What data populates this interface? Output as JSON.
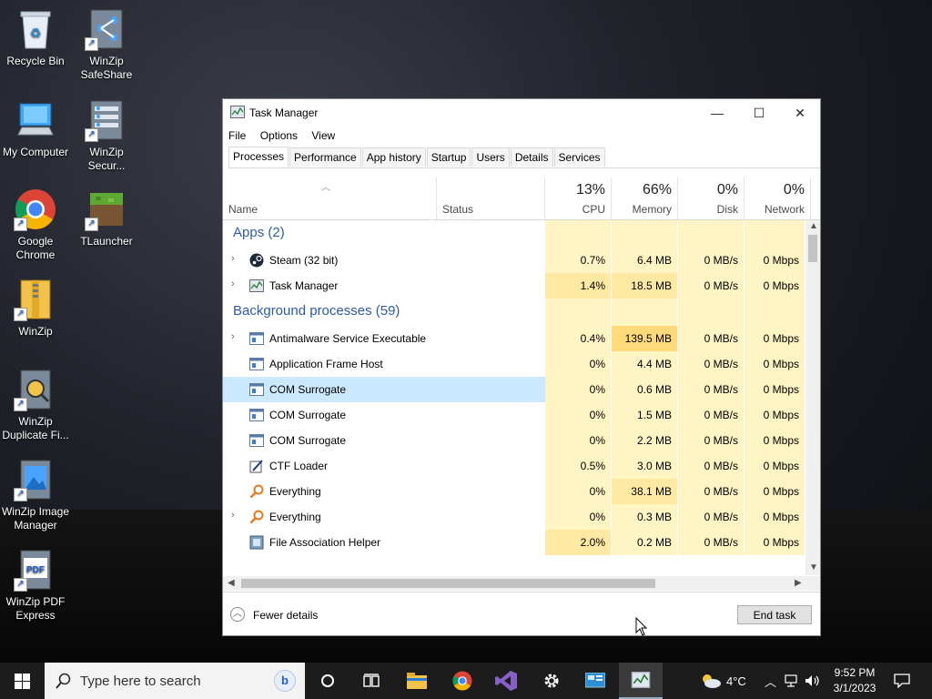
{
  "desktop": {
    "icons": [
      {
        "label": "Recycle Bin",
        "icon": "recycle-bin-icon"
      },
      {
        "label": "WinZip SafeShare",
        "icon": "winzip-safeshare-icon"
      },
      {
        "label": "My Computer",
        "icon": "computer-icon"
      },
      {
        "label": "WinZip Secur...",
        "icon": "winzip-secure-icon"
      },
      {
        "label": "Google Chrome",
        "icon": "chrome-icon"
      },
      {
        "label": "TLauncher",
        "icon": "tlauncher-icon"
      },
      {
        "label": "WinZip",
        "icon": "winzip-icon"
      },
      {
        "label": "WinZip Duplicate Fi...",
        "icon": "winzip-duplicate-icon"
      },
      {
        "label": "WinZip Image Manager",
        "icon": "winzip-image-icon"
      },
      {
        "label": "WinZip PDF Express",
        "icon": "winzip-pdf-icon"
      }
    ]
  },
  "window": {
    "title": "Task Manager",
    "controls": {
      "minimize": "—",
      "maximize": "☐",
      "close": "✕"
    },
    "menu": [
      "File",
      "Options",
      "View"
    ],
    "tabs": [
      "Processes",
      "Performance",
      "App history",
      "Startup",
      "Users",
      "Details",
      "Services"
    ],
    "active_tab": "Processes",
    "columns": {
      "name": "Name",
      "status": "Status",
      "cpu": {
        "pct": "13%",
        "label": "CPU"
      },
      "memory": {
        "pct": "66%",
        "label": "Memory"
      },
      "disk": {
        "pct": "0%",
        "label": "Disk"
      },
      "network": {
        "pct": "0%",
        "label": "Network"
      }
    },
    "groups": {
      "apps": "Apps (2)",
      "background": "Background processes (59)"
    },
    "apps": [
      {
        "name": "Steam (32 bit)",
        "cpu": "0.7%",
        "memory": "6.4 MB",
        "disk": "0 MB/s",
        "network": "0 Mbps",
        "expandable": true,
        "icon": "steam-icon"
      },
      {
        "name": "Task Manager",
        "cpu": "1.4%",
        "memory": "18.5 MB",
        "disk": "0 MB/s",
        "network": "0 Mbps",
        "expandable": true,
        "icon": "task-manager-icon"
      }
    ],
    "background": [
      {
        "name": "Antimalware Service Executable",
        "cpu": "0.4%",
        "memory": "139.5 MB",
        "disk": "0 MB/s",
        "network": "0 Mbps",
        "expandable": true,
        "icon": "service-icon"
      },
      {
        "name": "Application Frame Host",
        "cpu": "0%",
        "memory": "4.4 MB",
        "disk": "0 MB/s",
        "network": "0 Mbps",
        "expandable": false,
        "icon": "service-icon"
      },
      {
        "name": "COM Surrogate",
        "cpu": "0%",
        "memory": "0.6 MB",
        "disk": "0 MB/s",
        "network": "0 Mbps",
        "expandable": false,
        "icon": "service-icon",
        "selected": true
      },
      {
        "name": "COM Surrogate",
        "cpu": "0%",
        "memory": "1.5 MB",
        "disk": "0 MB/s",
        "network": "0 Mbps",
        "expandable": false,
        "icon": "service-icon"
      },
      {
        "name": "COM Surrogate",
        "cpu": "0%",
        "memory": "2.2 MB",
        "disk": "0 MB/s",
        "network": "0 Mbps",
        "expandable": false,
        "icon": "service-icon"
      },
      {
        "name": "CTF Loader",
        "cpu": "0.5%",
        "memory": "3.0 MB",
        "disk": "0 MB/s",
        "network": "0 Mbps",
        "expandable": false,
        "icon": "ctf-loader-icon"
      },
      {
        "name": "Everything",
        "cpu": "0%",
        "memory": "38.1 MB",
        "disk": "0 MB/s",
        "network": "0 Mbps",
        "expandable": false,
        "icon": "everything-search-icon"
      },
      {
        "name": "Everything",
        "cpu": "0%",
        "memory": "0.3 MB",
        "disk": "0 MB/s",
        "network": "0 Mbps",
        "expandable": true,
        "icon": "everything-search-icon"
      },
      {
        "name": "File Association Helper",
        "cpu": "2.0%",
        "memory": "0.2 MB",
        "disk": "0 MB/s",
        "network": "0 Mbps",
        "expandable": false,
        "icon": "file-association-icon"
      }
    ],
    "footer": {
      "fewer_details": "Fewer details",
      "end_task": "End task"
    }
  },
  "taskbar": {
    "search_placeholder": "Type here to search",
    "apps": [
      "cortana-icon",
      "task-view-icon",
      "file-explorer-icon",
      "chrome-icon",
      "visual-studio-icon",
      "settings-gear-icon",
      "control-panel-icon",
      "task-manager-icon"
    ],
    "weather": "4°C",
    "time": "9:52 PM",
    "date": "3/1/2023"
  },
  "colors": {
    "group_title": "#2e5aa8",
    "selected_row": "#cce8ff",
    "cell_light": "#fff4c4",
    "cell_medium": "#ffe9a3",
    "cell_heavy": "#ffd97a"
  }
}
